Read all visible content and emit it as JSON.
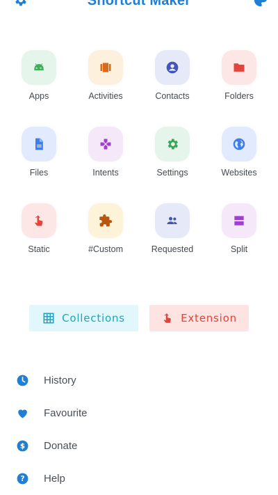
{
  "header": {
    "title": "Shortcut Maker",
    "left_icon": "settings-icon",
    "right_icon": "palette-icon",
    "accent": "#1f7fd6"
  },
  "tiles": [
    {
      "label": "Apps",
      "icon": "android-icon",
      "bg": "#e6f5ec",
      "fg": "#3fae5b"
    },
    {
      "label": "Activities",
      "icon": "carousel-icon",
      "bg": "#fdf0dc",
      "fg": "#d96a1b"
    },
    {
      "label": "Contacts",
      "icon": "contact-icon",
      "bg": "#e6e9f7",
      "fg": "#4356b4"
    },
    {
      "label": "Folders",
      "icon": "folder-icon",
      "bg": "#fde7e6",
      "fg": "#e3443b"
    },
    {
      "label": "Files",
      "icon": "file-icon",
      "bg": "#e2ebfd",
      "fg": "#3d7ee9"
    },
    {
      "label": "Intents",
      "icon": "gamepad-icon",
      "bg": "#f4e8f9",
      "fg": "#a23fd0"
    },
    {
      "label": "Settings",
      "icon": "gear-icon",
      "bg": "#e6f5ec",
      "fg": "#32a856"
    },
    {
      "label": "Websites",
      "icon": "globe-icon",
      "bg": "#e2ebfd",
      "fg": "#3d7ee9"
    },
    {
      "label": "Static",
      "icon": "touch-icon",
      "bg": "#fde7e6",
      "fg": "#e3443b"
    },
    {
      "label": "#Custom",
      "icon": "puzzle-icon",
      "bg": "#fdf3d8",
      "fg": "#b8570f"
    },
    {
      "label": "Requested",
      "icon": "people-icon",
      "bg": "#e6e9f7",
      "fg": "#4356b4"
    },
    {
      "label": "Split",
      "icon": "split-icon",
      "bg": "#f4e8f9",
      "fg": "#a23fd0"
    }
  ],
  "buttons": {
    "collections": {
      "label": "Collections",
      "icon": "grid-icon"
    },
    "extension": {
      "label": "Extension",
      "icon": "touch-icon"
    }
  },
  "menu": [
    {
      "label": "History",
      "icon": "clock-icon"
    },
    {
      "label": "Favourite",
      "icon": "heart-icon"
    },
    {
      "label": "Donate",
      "icon": "dollar-icon"
    },
    {
      "label": "Help",
      "icon": "help-icon"
    }
  ],
  "colors": {
    "menu_icon": "#1f7fd6",
    "collections_bg": "#e2f7fb",
    "collections_fg": "#1fa3c1",
    "extension_bg": "#fde4e2",
    "extension_fg": "#e0443a"
  }
}
